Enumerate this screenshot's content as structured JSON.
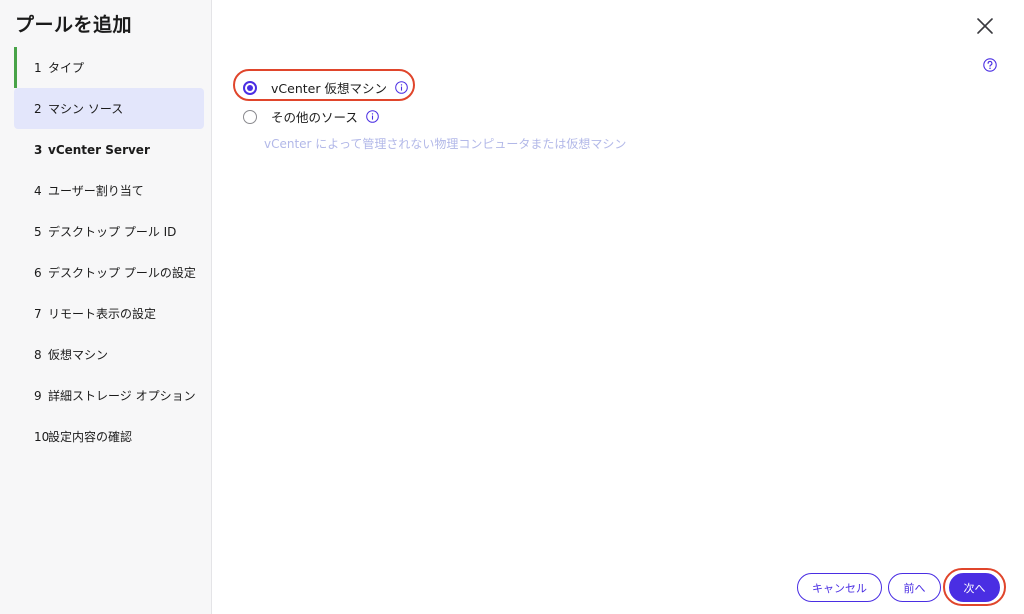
{
  "sidebar": {
    "title": "プールを追加",
    "steps": [
      {
        "num": "1",
        "label": "タイプ"
      },
      {
        "num": "2",
        "label": "マシン ソース"
      },
      {
        "num": "3",
        "label": "vCenter Server"
      },
      {
        "num": "4",
        "label": "ユーザー割り当て"
      },
      {
        "num": "5",
        "label": "デスクトップ プール ID"
      },
      {
        "num": "6",
        "label": "デスクトップ プールの設定"
      },
      {
        "num": "7",
        "label": "リモート表示の設定"
      },
      {
        "num": "8",
        "label": "仮想マシン"
      },
      {
        "num": "9",
        "label": "詳細ストレージ オプション"
      },
      {
        "num": "10",
        "label": "設定内容の確認"
      }
    ]
  },
  "main": {
    "options": [
      {
        "label": "vCenter 仮想マシン",
        "checked": true
      },
      {
        "label": "その他のソース",
        "checked": false
      }
    ],
    "description": "vCenter によって管理されない物理コンピュータまたは仮想マシン"
  },
  "footer": {
    "cancel_label": "キャンセル",
    "back_label": "前へ",
    "next_label": "次へ"
  },
  "colors": {
    "accent": "#4a2ee3",
    "highlight": "#e0452b",
    "done_bar": "#48a348",
    "active_step_bg": "#e3e6fb"
  }
}
